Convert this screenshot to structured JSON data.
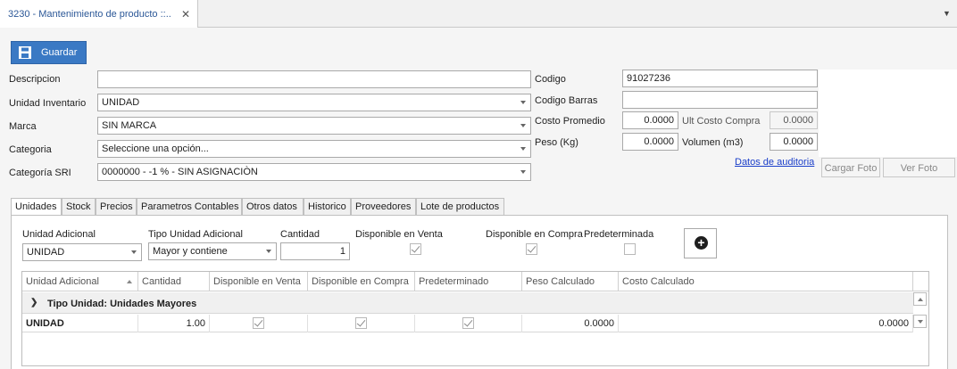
{
  "document_tab": {
    "title": "3230 - Mantenimiento de producto ::..",
    "close": "✕"
  },
  "toolbar": {
    "save_label": "Guardar",
    "save_icon": "floppy-disk-icon"
  },
  "form": {
    "descripcion_label": "Descripcion",
    "descripcion_value": "",
    "unidad_label": "Unidad Inventario",
    "unidad_value": "UNIDAD",
    "marca_label": "Marca",
    "marca_value": "SIN MARCA",
    "categoria_label": "Categoria",
    "categoria_value": "Seleccione una opción...",
    "categoria_sri_label": "Categoría SRI",
    "categoria_sri_value": "0000000 - -1 % - SIN ASIGNACIÒN",
    "codigo_label": "Codigo",
    "codigo_value": "91027236",
    "codigo_barras_label": "Codigo Barras",
    "codigo_barras_value": "",
    "costo_promedio_label": "Costo Promedio",
    "costo_promedio_value": "0.0000",
    "ult_costo_label": "Ult Costo Compra",
    "ult_costo_value": "0.0000",
    "peso_label": "Peso (Kg)",
    "peso_value": "0.0000",
    "volumen_label": "Volumen (m3)",
    "volumen_value": "0.0000",
    "auditoria_link": "Datos de auditoria",
    "cargar_foto": "Cargar Foto",
    "ver_foto": "Ver Foto"
  },
  "tabs": [
    {
      "label": "Unidades"
    },
    {
      "label": "Stock"
    },
    {
      "label": "Precios"
    },
    {
      "label": "Parametros Contables"
    },
    {
      "label": "Otros datos"
    },
    {
      "label": "Historico"
    },
    {
      "label": "Proveedores"
    },
    {
      "label": "Lote de productos"
    }
  ],
  "unidades": {
    "unidad_adicional_label": "Unidad Adicional",
    "unidad_adicional_value": "UNIDAD",
    "tipo_label": "Tipo Unidad Adicional",
    "tipo_value": "Mayor y contiene",
    "cantidad_label": "Cantidad",
    "cantidad_value": "1",
    "disp_venta_label": "Disponible en Venta",
    "disp_venta_checked": true,
    "disp_compra_label": "Disponible en Compra",
    "disp_compra_checked": true,
    "predeterminada_label": "Predeterminada",
    "predeterminada_checked": false,
    "add_icon": "plus-circle-icon"
  },
  "grid": {
    "columns": [
      "Unidad Adicional",
      "Cantidad",
      "Disponible en Venta",
      "Disponible en Compra",
      "Predeterminado",
      "Peso Calculado",
      "Costo Calculado"
    ],
    "group_label": "Tipo Unidad: Unidades Mayores",
    "rows": [
      {
        "unidad": "UNIDAD",
        "cantidad": "1.00",
        "venta": true,
        "compra": true,
        "predeterminado": true,
        "peso": "0.0000",
        "costo": "0.0000"
      }
    ]
  }
}
